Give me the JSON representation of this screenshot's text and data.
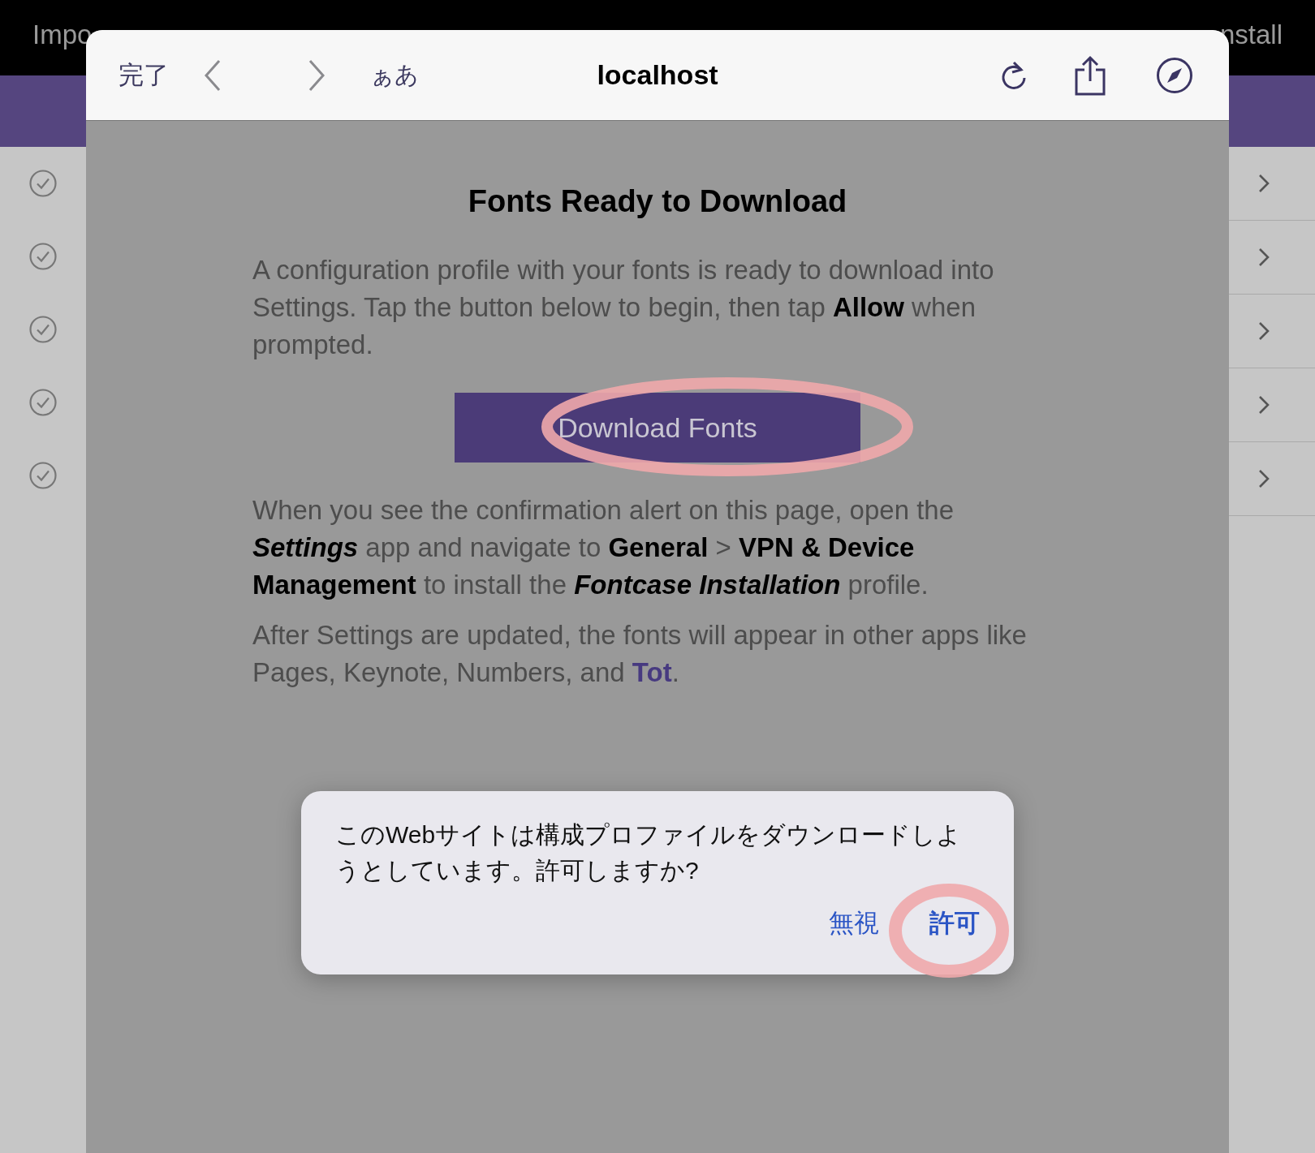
{
  "app_header": {
    "left": "Impo",
    "right": "nstall"
  },
  "list_rows": [
    {
      "checked": true
    },
    {
      "checked": true
    },
    {
      "checked": true
    },
    {
      "checked": true
    },
    {
      "checked": true
    }
  ],
  "browser": {
    "done": "完了",
    "text_size": "ぁあ",
    "address": "localhost"
  },
  "page": {
    "title": "Fonts Ready to Download",
    "intro": "A configuration profile with your fonts is ready to download into Settings. Tap the button below to begin, then tap **Allow** when prompted.",
    "button": "Download Fonts",
    "instructions": "When you see the confirmation alert on this page, open the *Settings* app and navigate to **General** > **VPN & Device Management** to install the *Fontcase Installation* profile.",
    "outro_before": "After Settings are updated, the fonts will appear in other apps like Pages, Keynote, Numbers, and ",
    "outro_link": "Tot",
    "outro_after": "."
  },
  "alert": {
    "message": "このWebサイトは構成プロファイルをダウンロードしようとしています。許可しますか?",
    "buttons": [
      {
        "label": "無視",
        "kind": "cancel"
      },
      {
        "label": "許可",
        "kind": "default"
      }
    ]
  }
}
